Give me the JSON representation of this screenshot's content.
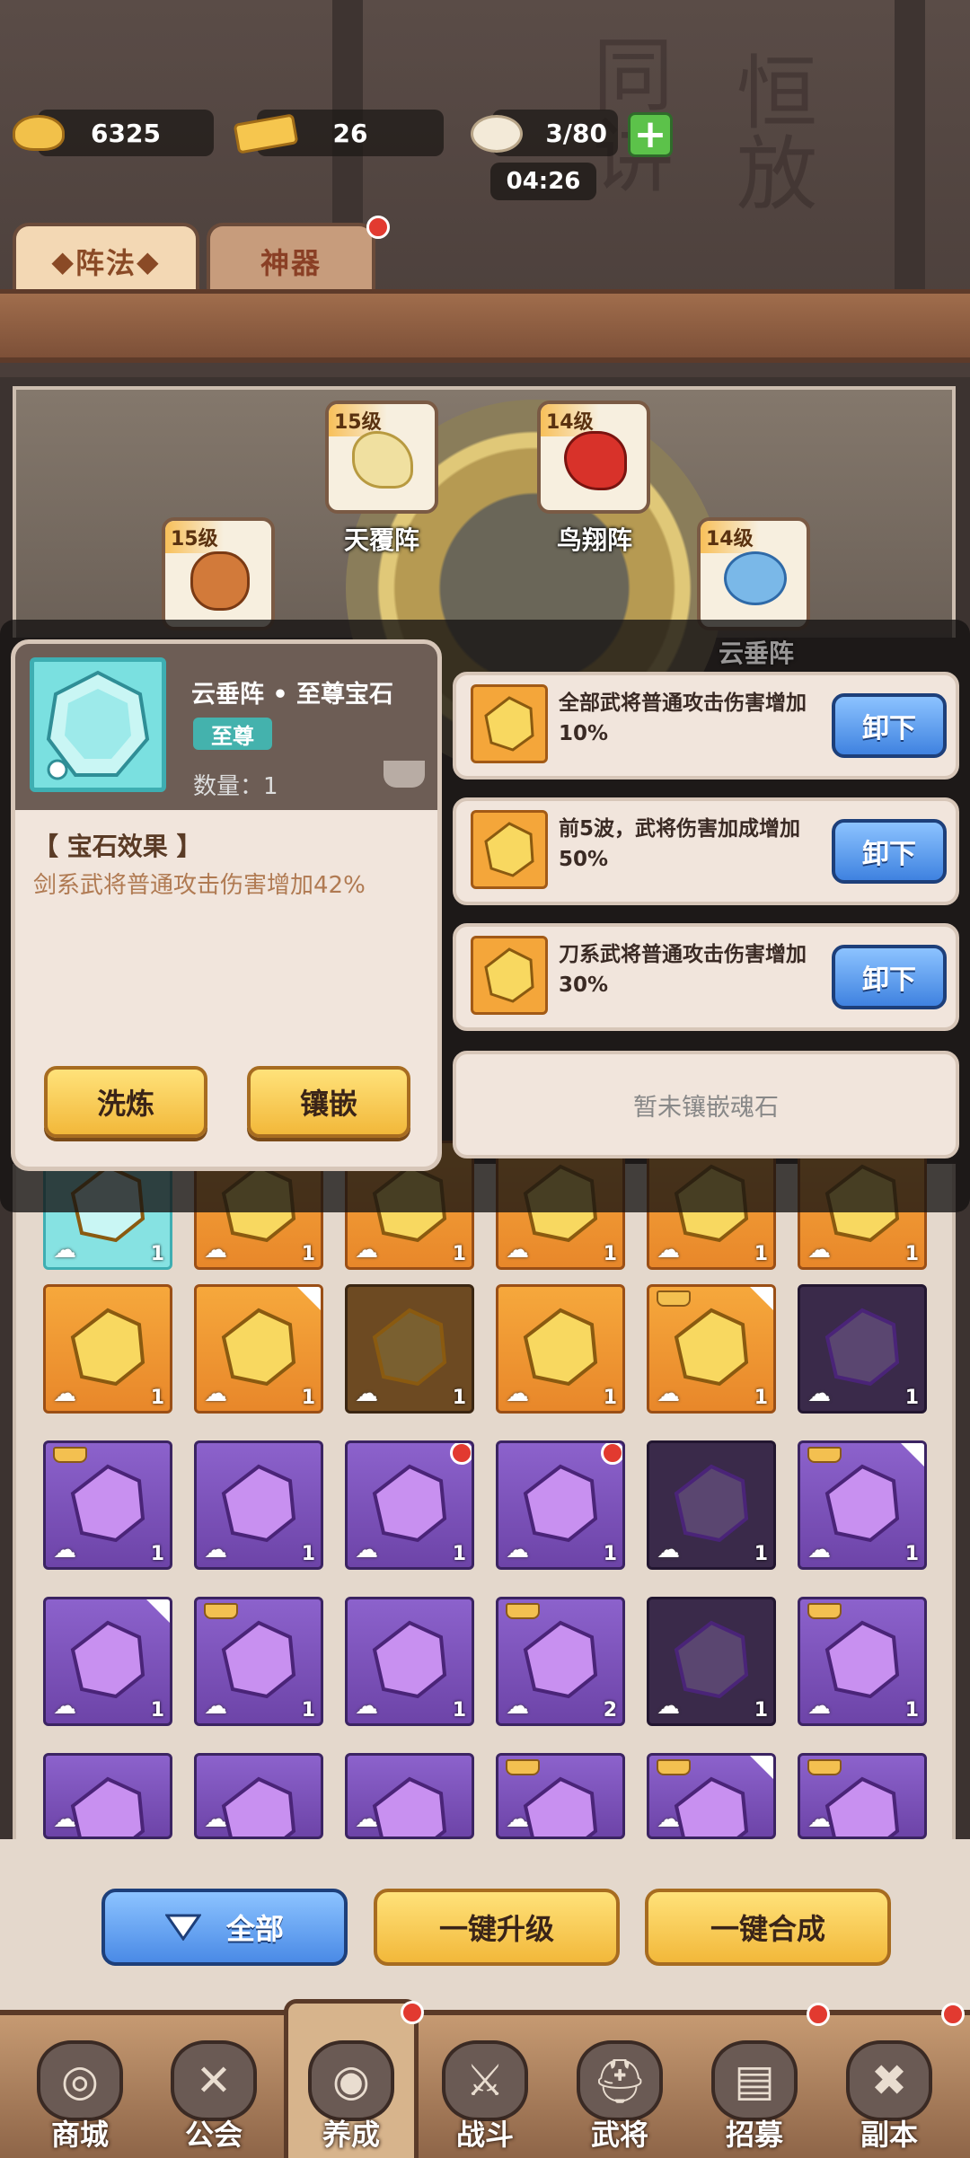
{
  "resources": {
    "gold": "6325",
    "ingot": "26",
    "stamina": "3/80",
    "timer": "04:26"
  },
  "tabs": [
    {
      "label": "阵法"
    },
    {
      "label": "神器"
    }
  ],
  "formations": [
    {
      "level": "15级",
      "name": "天覆阵"
    },
    {
      "level": "14级",
      "name": "鸟翔阵"
    },
    {
      "level": "15级",
      "name": ""
    },
    {
      "level": "14级",
      "name": "云垂阵"
    }
  ],
  "detail": {
    "title": "云垂阵 • 至尊宝石",
    "tier": "至尊",
    "quantity": "数量：1",
    "effect_header": "【 宝石效果 】",
    "effect_text": "剑系武将普通攻击伤害增加42%",
    "refine_button": "洗炼",
    "inlay_button": "镶嵌"
  },
  "slots": [
    {
      "text": "全部武将普通攻击伤害增加10%",
      "button": "卸下"
    },
    {
      "text": "前5波，武将伤害加成增加50%",
      "button": "卸下"
    },
    {
      "text": "刀系武将普通攻击伤害增加30%",
      "button": "卸下"
    }
  ],
  "empty_slot": "暂未镶嵌魂石",
  "grid": {
    "row0": [
      "1",
      "1",
      "1",
      "1",
      "1",
      "1"
    ],
    "row1": [
      "1",
      "1",
      "1",
      "1",
      "1",
      "1"
    ],
    "row2": [
      "1",
      "1",
      "1",
      "1",
      "1",
      "1"
    ],
    "row3": [
      "1",
      "1",
      "1",
      "2",
      "1",
      "1"
    ]
  },
  "actions": {
    "filter": "全部",
    "upgrade_all": "一键升级",
    "merge_all": "一键合成"
  },
  "nav": [
    {
      "label": "商城"
    },
    {
      "label": "公会"
    },
    {
      "label": "养成"
    },
    {
      "label": "战斗"
    },
    {
      "label": "武将"
    },
    {
      "label": "招募"
    },
    {
      "label": "副本"
    }
  ]
}
